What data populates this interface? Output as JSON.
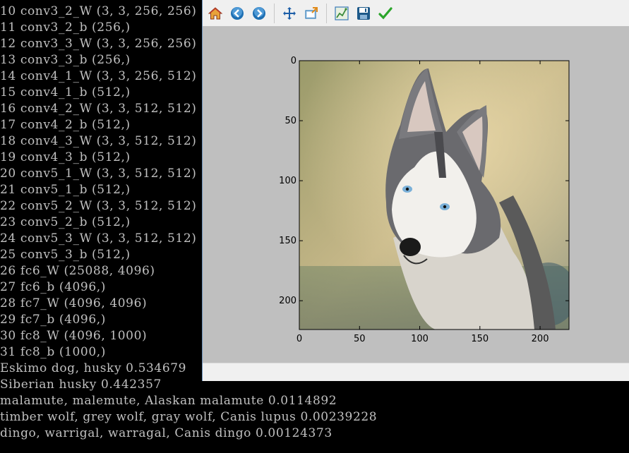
{
  "terminal": {
    "lines": [
      "10 conv3_2_W (3, 3, 256, 256)",
      "11 conv3_2_b (256,)",
      "12 conv3_3_W (3, 3, 256, 256)",
      "13 conv3_3_b (256,)",
      "14 conv4_1_W (3, 3, 256, 512)",
      "15 conv4_1_b (512,)",
      "16 conv4_2_W (3, 3, 512, 512)",
      "17 conv4_2_b (512,)",
      "18 conv4_3_W (3, 3, 512, 512)",
      "19 conv4_3_b (512,)",
      "20 conv5_1_W (3, 3, 512, 512)",
      "21 conv5_1_b (512,)",
      "22 conv5_2_W (3, 3, 512, 512)",
      "23 conv5_2_b (512,)",
      "24 conv5_3_W (3, 3, 512, 512)",
      "25 conv5_3_b (512,)",
      "26 fc6_W (25088, 4096)",
      "27 fc6_b (4096,)",
      "28 fc7_W (4096, 4096)",
      "29 fc7_b (4096,)",
      "30 fc8_W (4096, 1000)",
      "31 fc8_b (1000,)",
      "Eskimo dog, husky 0.534679",
      "Siberian husky 0.442357",
      "malamute, malemute, Alaskan malamute 0.0114892",
      "timber wolf, grey wolf, gray wolf, Canis lupus 0.00239228",
      "dingo, warrigal, warragal, Canis dingo 0.00124373"
    ]
  },
  "toolbar": {
    "buttons": [
      {
        "name": "home-icon",
        "color": "#c0392b"
      },
      {
        "name": "back-arrow-icon",
        "color": "#1e6fb3"
      },
      {
        "name": "forward-arrow-icon",
        "color": "#1e6fb3"
      },
      {
        "name": "pan-icon",
        "color": "#1e5fa8"
      },
      {
        "name": "zoom-rect-icon",
        "color": "#2a7ab8"
      },
      {
        "name": "subplots-icon",
        "color": "#3a8a3a"
      },
      {
        "name": "save-disk-icon",
        "color": "#1e5a8a"
      },
      {
        "name": "checkmark-icon",
        "color": "#2aa52a"
      }
    ]
  },
  "status": {
    "text": ""
  },
  "chart_data": {
    "type": "image",
    "subject": "Siberian husky photograph",
    "xticks": [
      0,
      50,
      100,
      150,
      200
    ],
    "yticks": [
      0,
      50,
      100,
      150,
      200
    ],
    "xlim": [
      0,
      224
    ],
    "ylim": [
      224,
      0
    ],
    "title": "",
    "xlabel": "",
    "ylabel": ""
  },
  "colors": {
    "terminal_bg": "#000000",
    "terminal_text": "#c0c0c0",
    "figure_bg": "#bfbfbf",
    "window_bg": "#f0f0f0"
  }
}
